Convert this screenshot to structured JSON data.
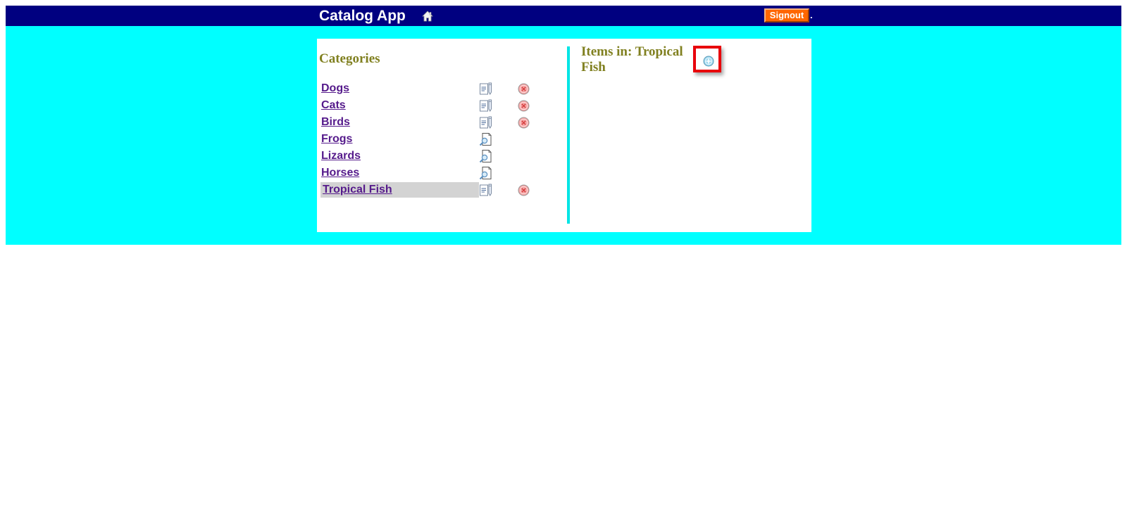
{
  "app": {
    "title": "Catalog App"
  },
  "header": {
    "signout_label": "Signout",
    "trailing_dot": "."
  },
  "categories": {
    "heading": "Categories",
    "items": [
      {
        "label": "Dogs",
        "action_icon": "edit-icon",
        "deletable": true
      },
      {
        "label": "Cats",
        "action_icon": "edit-icon",
        "deletable": true
      },
      {
        "label": "Birds",
        "action_icon": "edit-icon",
        "deletable": true
      },
      {
        "label": "Frogs",
        "action_icon": "view-icon",
        "deletable": false
      },
      {
        "label": "Lizards",
        "action_icon": "view-icon",
        "deletable": false
      },
      {
        "label": "Horses",
        "action_icon": "view-icon",
        "deletable": false
      },
      {
        "label": "Tropical Fish",
        "action_icon": "edit-icon",
        "deletable": true,
        "selected": true
      }
    ]
  },
  "items_panel": {
    "heading": "Items in: Tropical Fish"
  },
  "colors": {
    "topbar": "#000080",
    "background": "#00ffff",
    "heading": "#808020",
    "link": "#551a8b",
    "signout": "#ff6600",
    "highlight_box": "#e8000b"
  }
}
